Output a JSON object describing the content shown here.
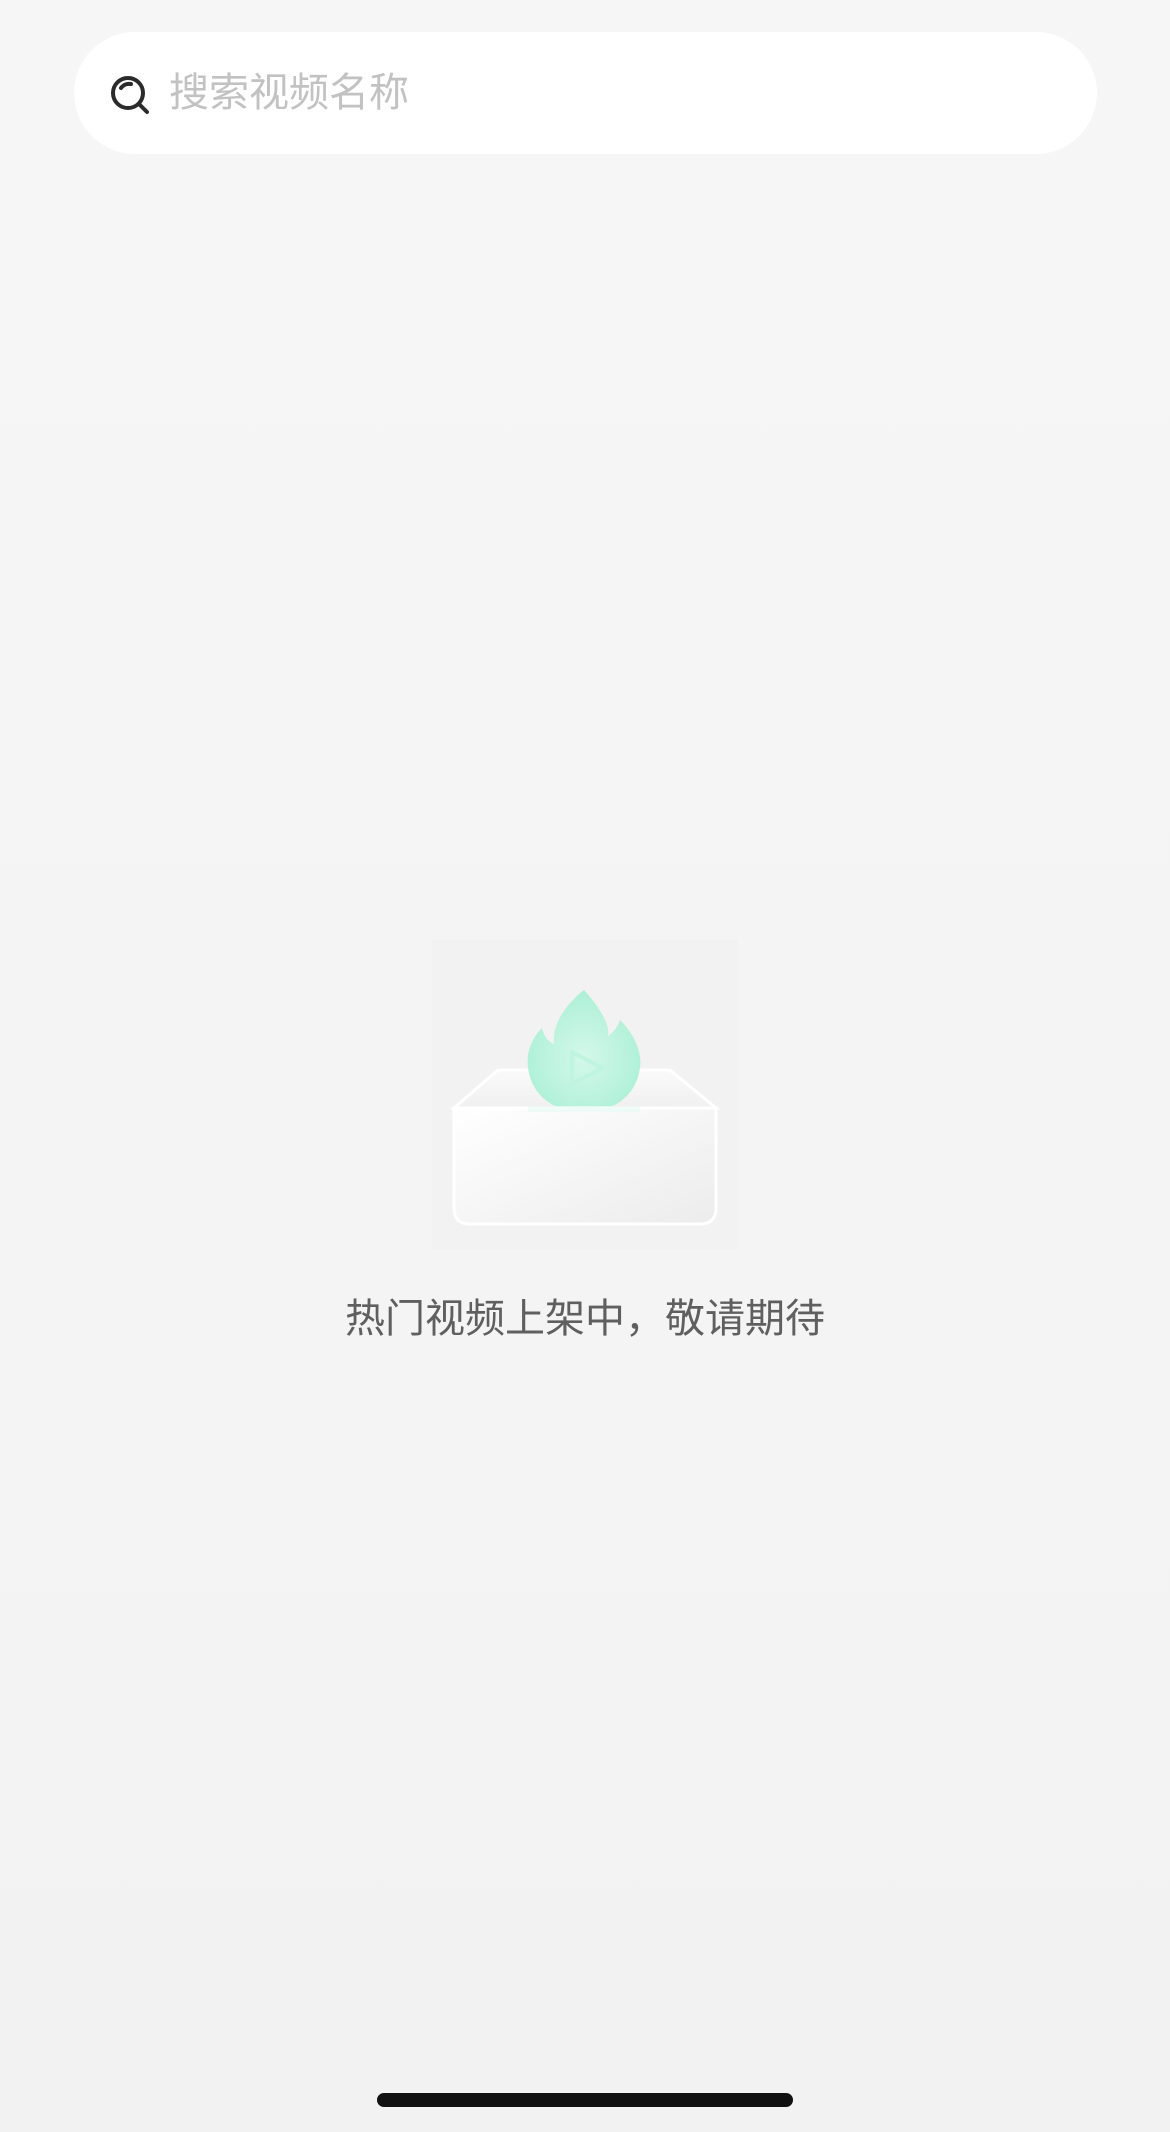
{
  "search": {
    "placeholder": "搜索视频名称",
    "icon": "search-icon"
  },
  "empty_state": {
    "message": "热门视频上架中，敬请期待",
    "illustration_icon": "flame-play-box-icon",
    "accent_color": "#a8f0d6"
  },
  "colors": {
    "background": "#f5f5f5",
    "search_background": "#ffffff",
    "placeholder_text": "#c2c2c2",
    "message_text": "#5f5f5f",
    "home_indicator": "#111111"
  }
}
